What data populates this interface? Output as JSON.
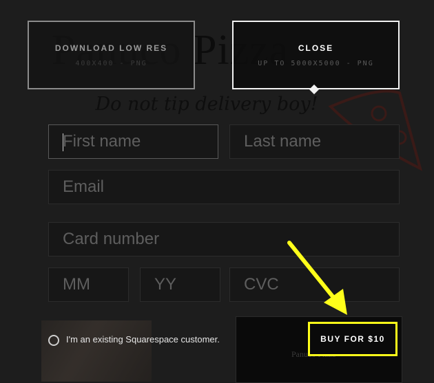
{
  "background": {
    "site_title": "Panuco Pizza",
    "tagline": "Do not tip delivery boy!"
  },
  "options": {
    "low_res": {
      "title": "DOWNLOAD LOW RES",
      "subtitle": "400X400 - PNG"
    },
    "high_res": {
      "title": "CLOSE",
      "subtitle": "UP TO 5000X5000 - PNG"
    }
  },
  "form": {
    "first_name": {
      "placeholder": "First name",
      "value": ""
    },
    "last_name": {
      "placeholder": "Last name",
      "value": ""
    },
    "email": {
      "placeholder": "Email",
      "value": ""
    },
    "card_number": {
      "placeholder": "Card number",
      "value": ""
    },
    "mm": {
      "placeholder": "MM",
      "value": ""
    },
    "yy": {
      "placeholder": "YY",
      "value": ""
    },
    "cvc": {
      "placeholder": "CVC",
      "value": ""
    }
  },
  "existing_customer": {
    "label": "I'm an existing Squarespace customer.",
    "checked": false
  },
  "buy_button": {
    "label": "BUY FOR $10"
  },
  "colors": {
    "accent_highlight": "#ffff1a",
    "background": "#1c1c1c",
    "selected_border": "#f2f2f2"
  },
  "icons": [
    "pizza-doodle-icon",
    "arrow-annotation-icon",
    "radio-icon"
  ]
}
